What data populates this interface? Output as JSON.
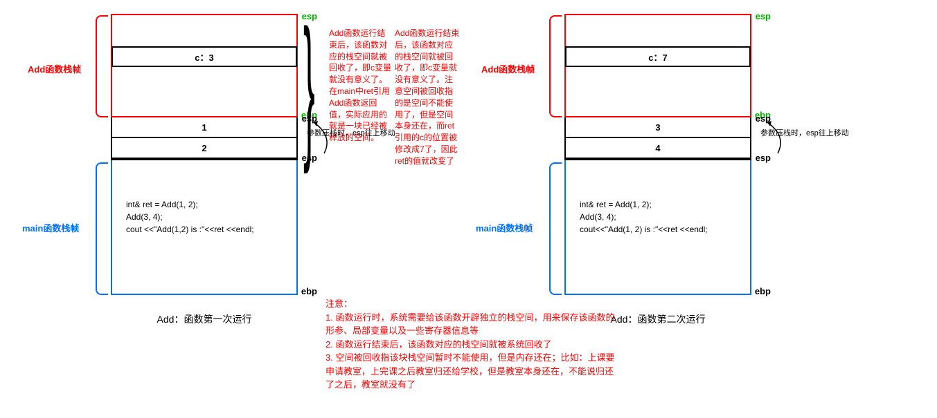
{
  "left": {
    "add_label": "Add函数栈帧",
    "main_label": "main函数栈帧",
    "c_cell": "c：3",
    "param1": "1",
    "param2": "2",
    "esp1": "esp",
    "ebp1": "ebp",
    "esp2": "esp",
    "esp3": "esp",
    "ebp2": "ebp",
    "push_note": "参数压栈时，esp往上移动",
    "code1": "int& ret = Add(1, 2);",
    "code2": "Add(3, 4);",
    "code3": "cout <<\"Add(1,2) is :\"<<ret <<endl;",
    "caption": "Add：函数第一次运行",
    "explain": "Add函数运行结束后，该函数对应的栈空间就被回收了，即c变量就没有意义了。在main中ret引用Add函数返回值，实际应用的就是一块已经被释放的空间。"
  },
  "right": {
    "add_label": "Add函数栈帧",
    "main_label": "main函数栈帧",
    "c_cell": "c：7",
    "param1": "3",
    "param2": "4",
    "esp1": "esp",
    "ebp1": "ebp",
    "esp2": "esp",
    "esp3": "esp",
    "ebp2": "ebp",
    "push_note": "参数压栈时，esp往上移动",
    "code1": "int& ret = Add(1, 2);",
    "code2": "Add(3, 4);",
    "code3": "cout<<\"Add(1, 2) is :\"<<ret <<endl;",
    "caption": "Add：函数第二次运行",
    "explain": "Add函数运行结束后，该函数对应的栈空间就被回收了，即c变量就没有意义了。注意空间被回收指的是空间不能使用了，但是空间本身还在，而ret引用的c的位置被修改成7了，因此ret的值就改变了"
  },
  "notes": {
    "title": "注意：",
    "n1": "1. 函数运行时，系统需要给该函数开辟独立的栈空间，用来保存该函数的形参、局部变量以及一些寄存器信息等",
    "n2": "2. 函数运行结束后，该函数对应的栈空间就被系统回收了",
    "n3": "3. 空间被回收指该块栈空间暂时不能使用，但是内存还在；比如：上课要申请教室，上完课之后教室归还给学校，但是教室本身还在，不能说归还了之后，教室就没有了"
  }
}
